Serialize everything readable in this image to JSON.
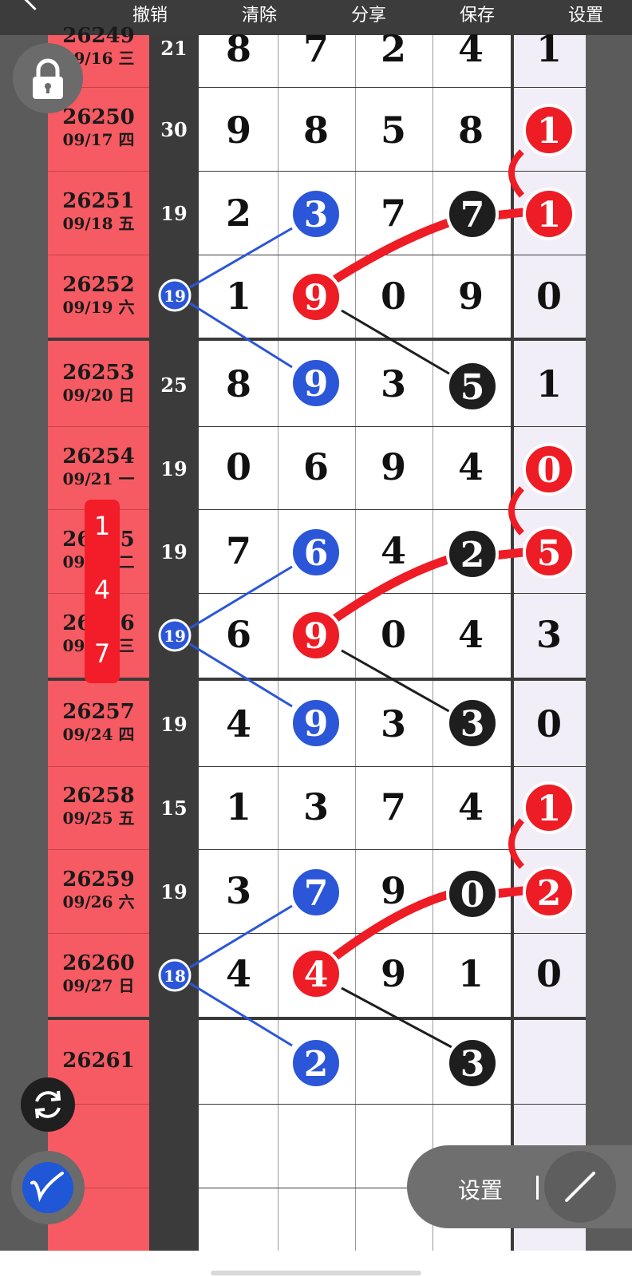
{
  "toolbar": {
    "undo": "撤销",
    "clear": "清除",
    "share": "分享",
    "save": "保存",
    "settings": "设置"
  },
  "rows": [
    {
      "period": "26249",
      "date": "09/16 三",
      "sum": "21",
      "digits": [
        "8",
        "7",
        "2",
        "4"
      ],
      "tail": "1"
    },
    {
      "period": "26250",
      "date": "09/17 四",
      "sum": "30",
      "digits": [
        "9",
        "8",
        "5",
        "8"
      ],
      "tail": "1"
    },
    {
      "period": "26251",
      "date": "09/18 五",
      "sum": "19",
      "digits": [
        "2",
        "3",
        "7",
        "7"
      ],
      "tail": "1"
    },
    {
      "period": "26252",
      "date": "09/19 六",
      "sum": "19",
      "digits": [
        "1",
        "9",
        "0",
        "9"
      ],
      "tail": "0"
    },
    {
      "period": "26253",
      "date": "09/20 日",
      "sum": "25",
      "digits": [
        "8",
        "9",
        "3",
        "5"
      ],
      "tail": "1"
    },
    {
      "period": "26254",
      "date": "09/21 一",
      "sum": "19",
      "digits": [
        "0",
        "6",
        "9",
        "4"
      ],
      "tail": "0"
    },
    {
      "period": "26255",
      "date": "09/22 二",
      "sum": "19",
      "digits": [
        "7",
        "6",
        "4",
        "2"
      ],
      "tail": "5"
    },
    {
      "period": "26256",
      "date": "09/23 三",
      "sum": "",
      "digits": [
        "6",
        "9",
        "0",
        "4"
      ],
      "tail": "3"
    },
    {
      "period": "26257",
      "date": "09/24 四",
      "sum": "19",
      "digits": [
        "4",
        "9",
        "3",
        "3"
      ],
      "tail": "0"
    },
    {
      "period": "26258",
      "date": "09/25 五",
      "sum": "15",
      "digits": [
        "1",
        "3",
        "7",
        "4"
      ],
      "tail": "1"
    },
    {
      "period": "26259",
      "date": "09/26 六",
      "sum": "19",
      "digits": [
        "3",
        "7",
        "9",
        "0"
      ],
      "tail": "2"
    },
    {
      "period": "26260",
      "date": "09/27 日",
      "sum": "",
      "digits": [
        "4",
        "4",
        "9",
        "1"
      ],
      "tail": "0"
    },
    {
      "period": "26261",
      "date": "",
      "sum": "",
      "digits": [
        "",
        "2",
        "",
        "3"
      ],
      "tail": ""
    }
  ],
  "markers": {
    "sum_markers": [
      "19",
      "19",
      "18"
    ]
  },
  "digit_popup": [
    "1",
    "4",
    "7"
  ],
  "bottom_pill": {
    "label": "设置"
  },
  "colors": {
    "period_bg": "#f65a62",
    "sum_bg": "#3b3b3b",
    "blue": "#2b56d8",
    "red": "#ee1c25",
    "black": "#1e1e1e",
    "tail_bg": "#f2eef8"
  },
  "icons": {
    "lock": "lock-icon",
    "refresh": "refresh-icon",
    "pen": "pen-icon",
    "line_tool": "line-tool-icon",
    "back": "back-arrow-icon"
  }
}
